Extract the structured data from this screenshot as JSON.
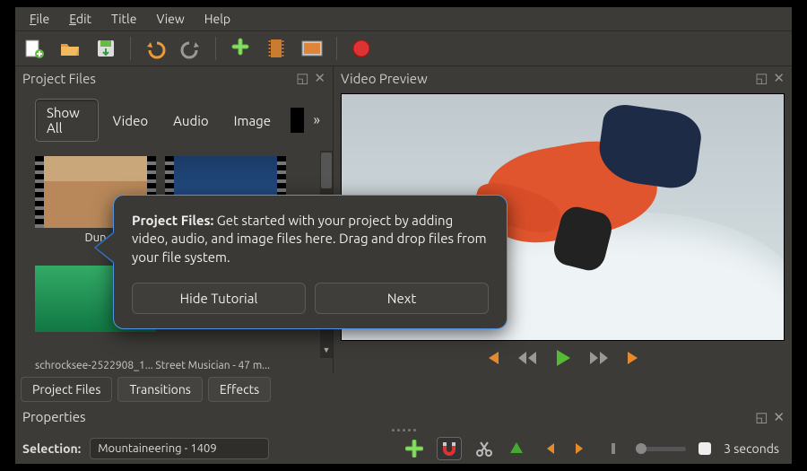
{
  "menus": {
    "file": "File",
    "edit": "Edit",
    "title": "Title",
    "view": "View",
    "help": "Help"
  },
  "panels": {
    "project_files": "Project Files",
    "video_preview": "Video Preview",
    "properties": "Properties"
  },
  "filters": {
    "show_all": "Show All",
    "video": "Video",
    "audio": "Audio",
    "image": "Image"
  },
  "thumbs": [
    {
      "caption": "Dun"
    },
    {
      "caption": ""
    },
    {
      "caption": ""
    }
  ],
  "file_strip": "schrocksee-2522908_1...   Street Musician - 47 m...",
  "tabs": {
    "project_files": "Project Files",
    "transitions": "Transitions",
    "effects": "Effects"
  },
  "selection": {
    "label": "Selection:",
    "value": "Mountaineering - 1409"
  },
  "timeline": {
    "seconds_label": "3 seconds"
  },
  "tutorial": {
    "heading": "Project Files:",
    "body": "Get started with your project by adding video, audio, and image files here. Drag and drop files from your file system.",
    "hide": "Hide Tutorial",
    "next": "Next"
  }
}
